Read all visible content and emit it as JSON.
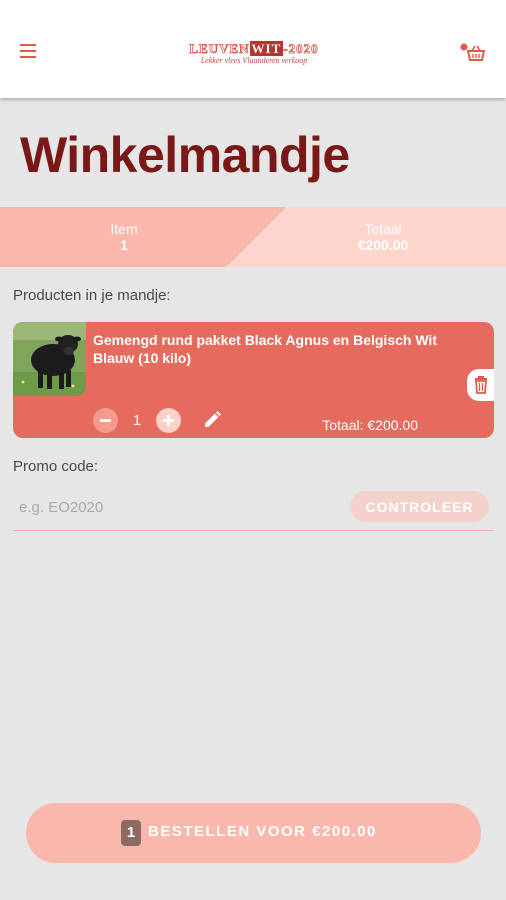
{
  "header": {
    "logo_prefix": "LEUVEN",
    "logo_wit": "WIT",
    "logo_year": "-2020",
    "logo_tagline": "Lekker vlees Vlaanderen verkoop"
  },
  "page": {
    "title": "Winkelmandje"
  },
  "summary": {
    "item_label": "Item",
    "item_value": "1",
    "total_label": "Totaal",
    "total_value": "€200.00"
  },
  "products": {
    "section_label": "Producten in je mandje:",
    "items": [
      {
        "title": "Gemengd rund pakket Black Agnus en Belgisch Wit Blauw (10 kilo)",
        "quantity": "1",
        "total": "Totaal: €200.00"
      }
    ]
  },
  "promo": {
    "label": "Promo code:",
    "placeholder": "e.g. EO2020",
    "button_label": "CONTROLEER"
  },
  "order": {
    "count": "1",
    "label": "BESTELLEN VOOR €200.00"
  },
  "colors": {
    "accent": "#e56b5e",
    "title": "#7a1717",
    "light_accent": "#f9b8ab"
  }
}
